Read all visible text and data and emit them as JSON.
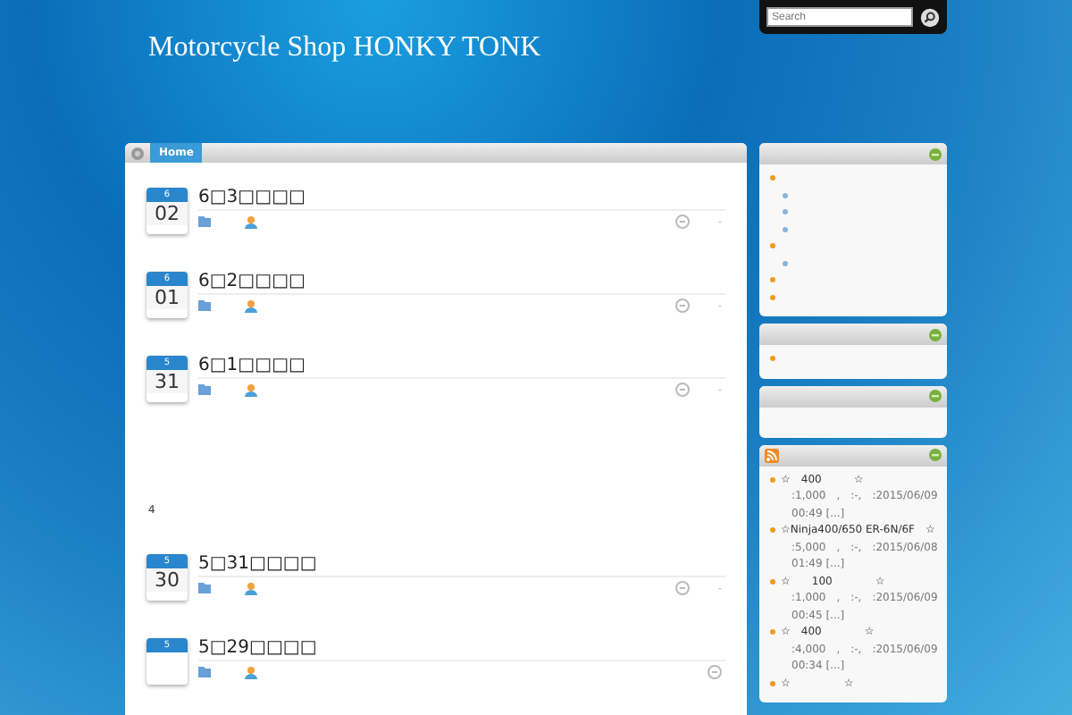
{
  "site_title": "Motorcycle Shop HONKY TONK",
  "search": {
    "placeholder": "Search"
  },
  "tabs": [
    {
      "label": "Home",
      "selected": true
    }
  ],
  "posts": [
    {
      "month": "6",
      "day": "02",
      "title": "6□3□□□□",
      "comments": "-"
    },
    {
      "month": "6",
      "day": "01",
      "title": "6□2□□□□",
      "comments": "-"
    },
    {
      "month": "5",
      "day": "31",
      "title": "6□1□□□□",
      "comments": "-",
      "excerpt": "4"
    },
    {
      "month": "5",
      "day": "30",
      "title": "5□31□□□□",
      "comments": "-"
    },
    {
      "month": "5",
      "title": "5□29□□□□"
    }
  ],
  "widgets": [
    {
      "kind": "list",
      "items": [
        {
          "kind": "category",
          "children": [
            {
              "kind": "subcategory"
            },
            {
              "kind": "subcategory"
            },
            {
              "kind": "subcategory"
            }
          ]
        },
        {
          "kind": "category",
          "children": [
            {
              "kind": "subcategory"
            }
          ]
        },
        {
          "kind": "category"
        },
        {
          "kind": "category"
        }
      ]
    },
    {
      "kind": "list",
      "items": [
        {
          "kind": "category"
        }
      ]
    },
    {
      "kind": "list"
    },
    {
      "kind": "feed",
      "entries": [
        {
          "title": "☆　400　　　☆",
          "meta": ":1,000　,　:-,　:2015/06/09 00:49 [...]"
        },
        {
          "title": "☆Ninja400/650 ER-6N/6F　☆",
          "meta": ":5,000　,　:-,　:2015/06/08 01:49 [...]"
        },
        {
          "title": "☆　　100　　　　☆",
          "meta": ":1,000　,　:-,　:2015/06/09 00:45 [...]"
        },
        {
          "title": "☆　400　　　　☆",
          "meta": ":4,000　,　:-,　:2015/06/09 00:34 [...]"
        },
        {
          "title": "☆　　　　　☆"
        }
      ]
    }
  ]
}
